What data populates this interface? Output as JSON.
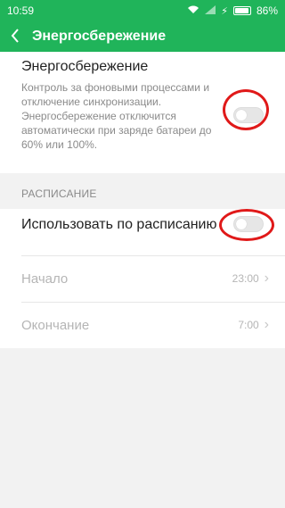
{
  "status_bar": {
    "time": "10:59",
    "battery": "86%",
    "battery_level": 0.86
  },
  "app_bar": {
    "back_icon": "chevron-left-icon",
    "title": "Энергосбережение"
  },
  "power_saving": {
    "title": "Энергосбережение",
    "description": "Контроль за фоновыми процессами и отключение синхронизации. Энергосбережение отключится автоматически при заряде батареи до 60% или 100%.",
    "enabled": false
  },
  "schedule": {
    "section_label": "РАСПИСАНИЕ",
    "use_schedule_label": "Использовать по расписанию",
    "use_schedule_enabled": false,
    "start": {
      "label": "Начало",
      "value": "23:00"
    },
    "end": {
      "label": "Окончание",
      "value": "7:00"
    }
  },
  "colors": {
    "accent": "#20b45a",
    "highlight_ring": "#e01919"
  }
}
